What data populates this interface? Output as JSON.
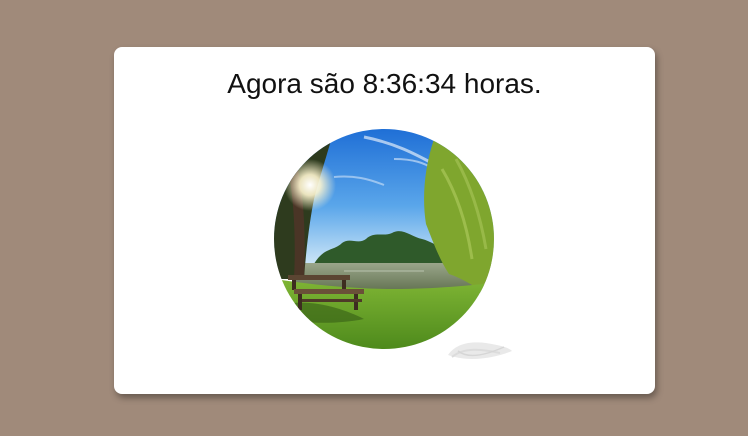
{
  "greeting": {
    "time_text": "Agora são 8:36:34 horas."
  },
  "photo": {
    "subject": "park-lake-landscape",
    "colors": {
      "sky_top": "#2f7fe0",
      "sky_bottom": "#cfe6f7",
      "foliage": "#8fb43a",
      "grass": "#6fa52a",
      "water": "#7d8f72",
      "trunk": "#4a3526"
    }
  },
  "colors": {
    "page_background": "#a08a7a",
    "card_background": "#ffffff",
    "text": "#111111"
  }
}
